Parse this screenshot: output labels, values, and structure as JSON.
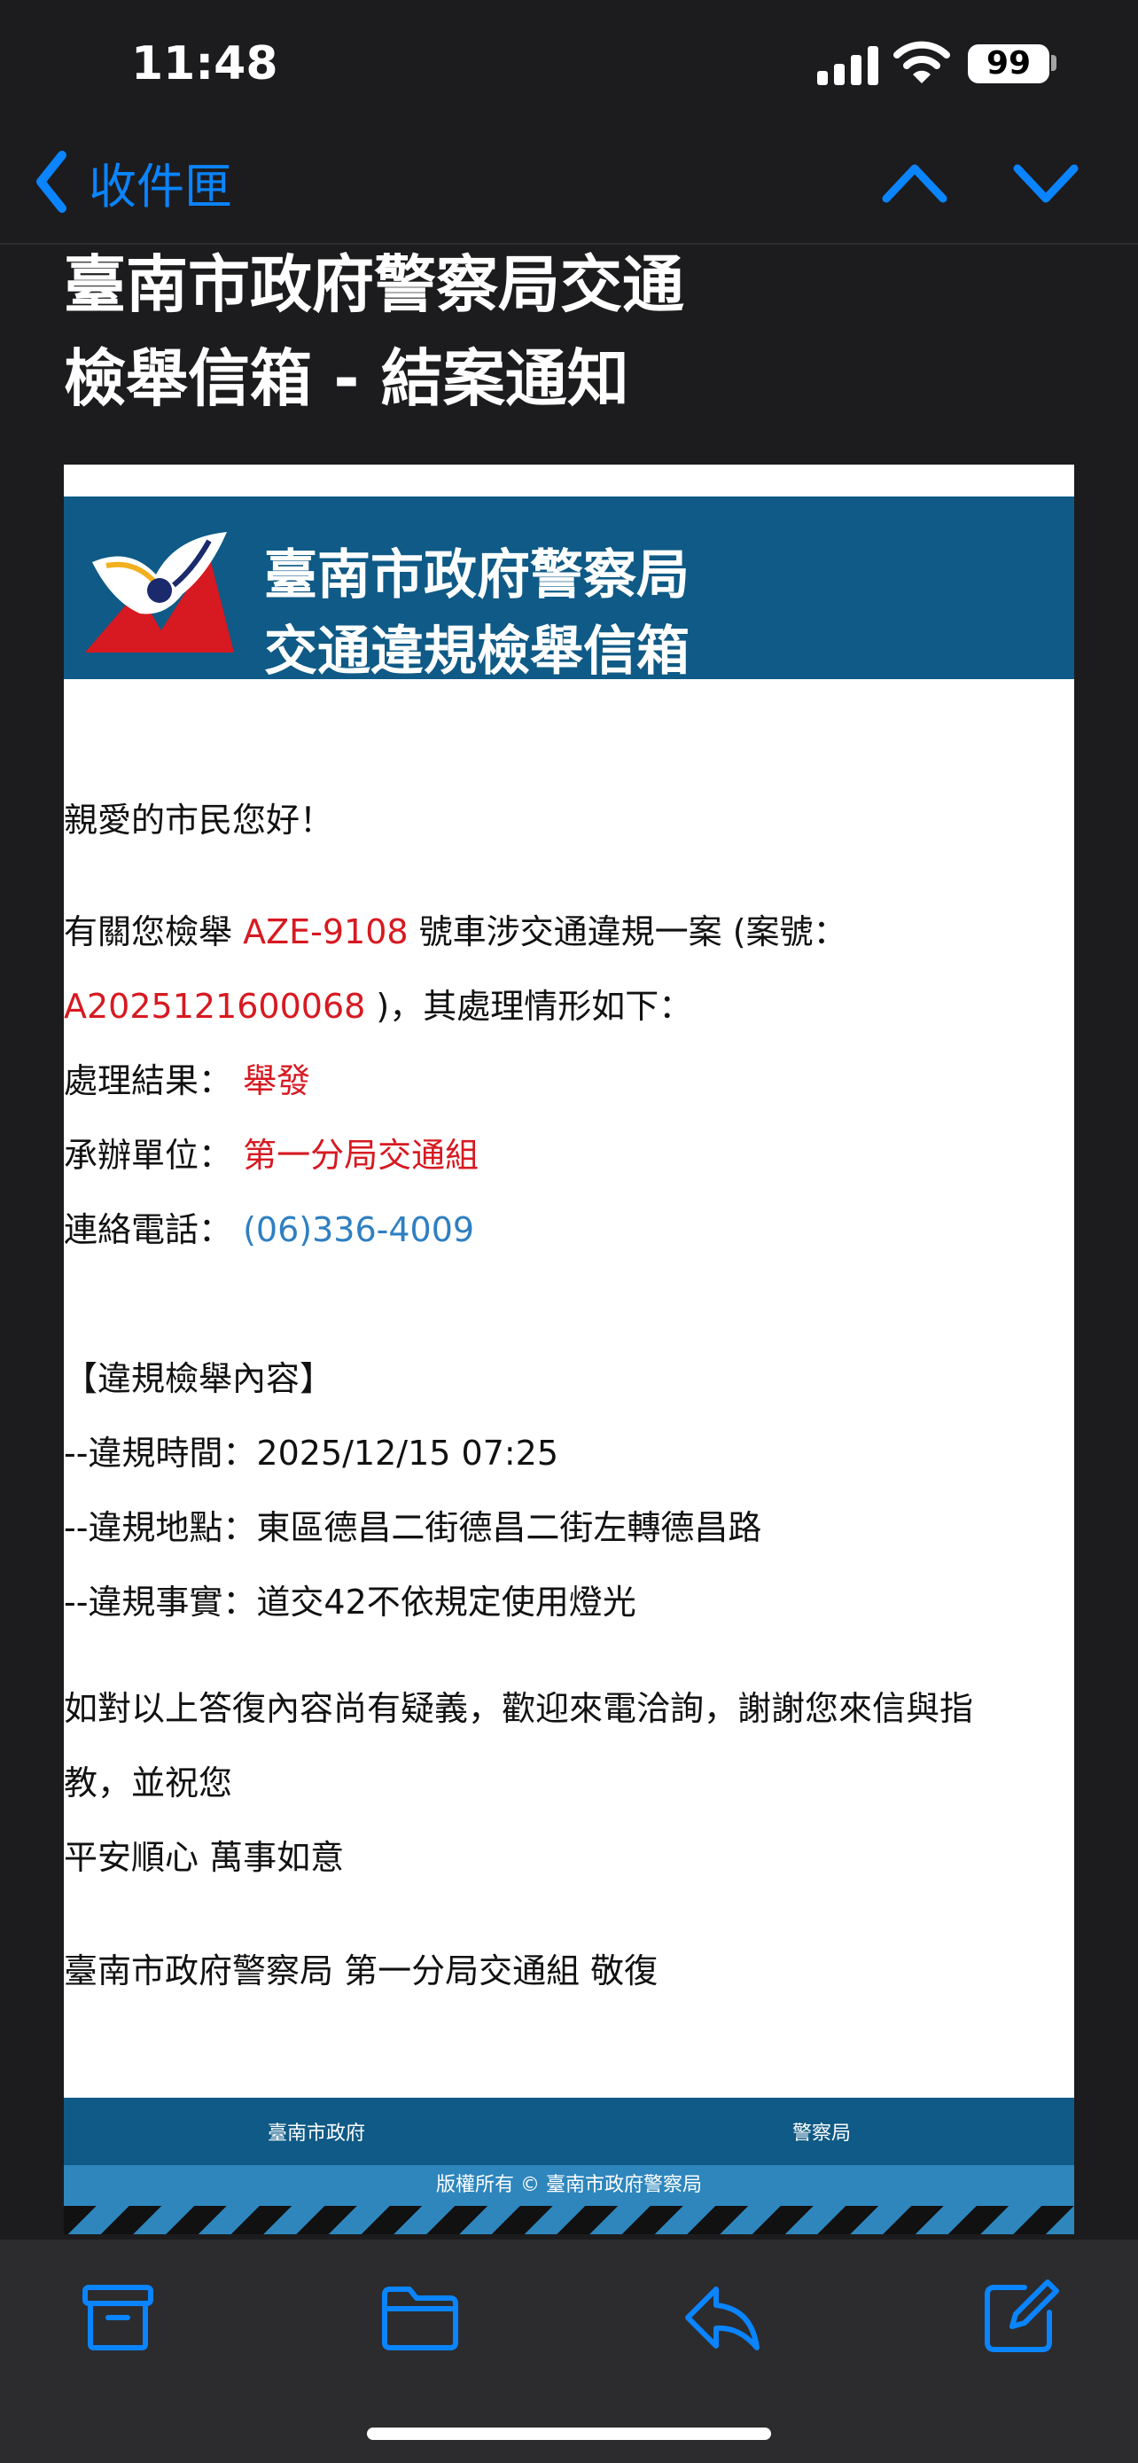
{
  "status_bar": {
    "time": "11:48",
    "battery": "99"
  },
  "nav": {
    "back_label": "收件匣"
  },
  "subject": {
    "line1": "臺南市政府警察局交通",
    "line2": "檢舉信箱 - 結案通知"
  },
  "banner": {
    "line1": "臺南市政府警察局",
    "line2": "交通違規檢舉信箱"
  },
  "body": {
    "greeting": "親愛的市民您好！",
    "intro_prefix": "有關您檢舉 ",
    "plate": "AZE-9108",
    "intro_suffix": " 號車涉交通違規一案 (案號：",
    "case_number": "A2025121600068",
    "intro_end": " )，其處理情形如下：",
    "result_label": "處理結果：",
    "result_value": "舉發",
    "unit_label": "承辦單位：",
    "unit_value": "第一分局交通組",
    "phone_label": "連絡電話：",
    "phone_value": "(06)336-4009",
    "section_title": "【違規檢舉內容】",
    "time_line": "--違規時間：2025/12/15 07:25",
    "place_line": "--違規地點：東區德昌二街德昌二街左轉德昌路",
    "fact_line": "--違規事實：道交42不依規定使用燈光",
    "closing1": "如對以上答復內容尚有疑義，歡迎來電洽詢，謝謝您來信與指",
    "closing2": "教，並祝您",
    "closing3": "平安順心 萬事如意",
    "signature": "臺南市政府警察局 第一分局交通組 敬復"
  },
  "footer": {
    "link_left": "臺南市政府",
    "link_right": "警察局",
    "copyright": "版權所有 © 臺南市政府警察局"
  },
  "colors": {
    "accent": "#0a84ff",
    "banner": "#0f5a86",
    "highlight_red": "#d71921",
    "link_blue": "#2f7fc1"
  },
  "toolbar": {
    "icons": [
      "archive-icon",
      "folder-icon",
      "reply-icon",
      "compose-icon"
    ]
  }
}
